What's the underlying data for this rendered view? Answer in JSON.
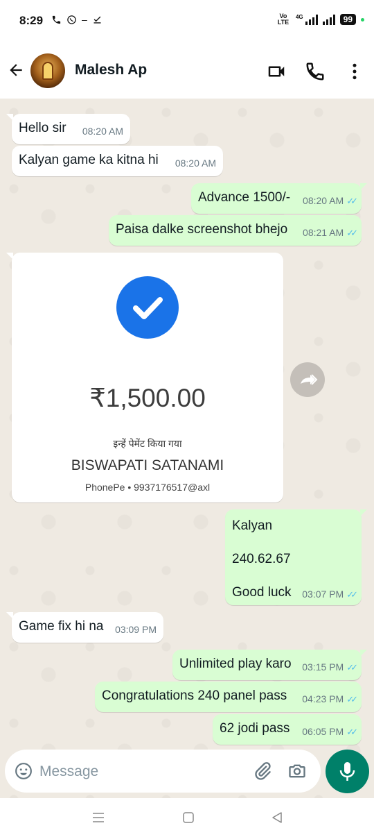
{
  "status_bar": {
    "time": "8:29",
    "network_label": "Vo LTE",
    "network_type": "4G",
    "battery": "99"
  },
  "header": {
    "contact_name": "Malesh Ap"
  },
  "messages": [
    {
      "dir": "in",
      "text": "Hello sir",
      "time": "08:20 AM"
    },
    {
      "dir": "in",
      "text": "Kalyan game ka kitna hi",
      "time": "08:20 AM"
    },
    {
      "dir": "out",
      "text": "Advance 1500/-",
      "time": "08:20 AM",
      "read": true
    },
    {
      "dir": "out",
      "text": "Paisa dalke screenshot bhejo",
      "time": "08:21 AM",
      "read": true
    },
    {
      "dir": "out",
      "lines": [
        "Kalyan",
        "240.62.67",
        "Good luck"
      ],
      "time": "03:07 PM",
      "read": true
    },
    {
      "dir": "in",
      "text": "Game fix hi na",
      "time": "03:09 PM"
    },
    {
      "dir": "out",
      "text": "Unlimited play karo",
      "time": "03:15 PM",
      "read": true
    },
    {
      "dir": "out",
      "text": "Congratulations 240 panel pass",
      "time": "04:23 PM",
      "read": true
    },
    {
      "dir": "out",
      "text": "62 jodi pass",
      "time": "06:05 PM",
      "read": true
    }
  ],
  "payment": {
    "amount": "₹1,500.00",
    "paid_to_label": "इन्हें पेमेंट किया गया",
    "payee_name": "BISWAPATI SATANAMI",
    "payee_upi": "PhonePe • 9937176517@axl"
  },
  "input": {
    "placeholder": "Message"
  },
  "colors": {
    "chat_bg": "#efeae2",
    "outgoing_bubble": "#d9fdd3",
    "incoming_bubble": "#ffffff",
    "read_ticks": "#53bdeb",
    "mic_button": "#008069",
    "check_circle": "#1a73e8"
  },
  "icons": [
    "call-icon",
    "whatsapp-icon",
    "back-arrow-icon",
    "video-call-icon",
    "phone-icon",
    "more-vert-icon",
    "forward-icon",
    "emoji-icon",
    "attach-icon",
    "camera-icon",
    "mic-icon",
    "menu-icon",
    "home-icon",
    "back-icon"
  ]
}
